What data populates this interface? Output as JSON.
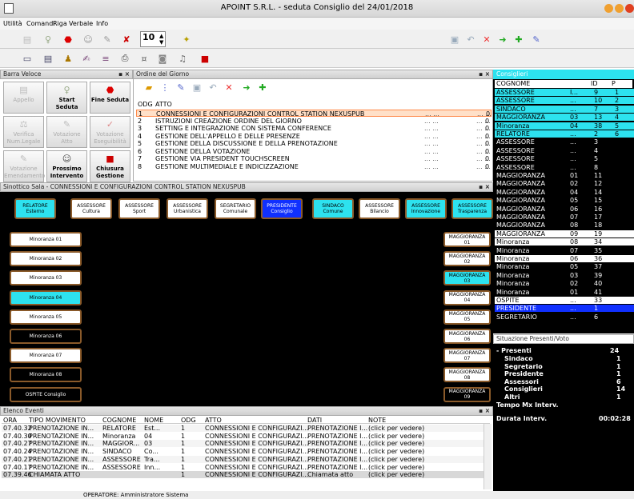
{
  "window": {
    "title": "APOINT S.R.L. - seduta  Consiglio  del  24/01/2018"
  },
  "menu": [
    "Utilità",
    "Comandi",
    "Riga",
    "Verbale",
    "Info"
  ],
  "toolbar1": {
    "zoom_value": "10"
  },
  "quick": {
    "title": "Barra Veloce",
    "buttons": [
      {
        "label": "Appello",
        "icon": "document-icon",
        "enabled": false
      },
      {
        "label": "Start Seduta",
        "icon": "bell-icon",
        "enabled": true
      },
      {
        "label": "Fine Seduta",
        "icon": "stop-icon",
        "enabled": true
      },
      {
        "label": "Verifica Num.Legale",
        "icon": "gavel-icon",
        "enabled": false
      },
      {
        "label": "Votazione Atto",
        "icon": "vote-icon",
        "enabled": false
      },
      {
        "label": "Votazione Eseguibilità",
        "icon": "check-icon",
        "enabled": false
      },
      {
        "label": "Votazione Emendamento",
        "icon": "vote-icon",
        "enabled": false
      },
      {
        "label": "Prossimo Intervento",
        "icon": "speech-icon",
        "enabled": true
      },
      {
        "label": "Chiusura Gestione",
        "icon": "stop-square-icon",
        "enabled": true
      }
    ]
  },
  "odg": {
    "title": "Ordine del Giorno",
    "col_odg": "ODG",
    "col_atto": "ATTO",
    "rows": [
      {
        "n": "1",
        "atto": "CONNESSIONI E CONFIGURAZIONI CONTROL STATION NEXUSPUB",
        "v": "0"
      },
      {
        "n": "2",
        "atto": "ISTRUZIONI CREAZIONE ORDINE DEL GIORNO",
        "v": "0"
      },
      {
        "n": "3",
        "atto": "SETTING E INTEGRAZIONE CON SISTEMA CONFERENCE",
        "v": "0"
      },
      {
        "n": "4",
        "atto": "GESTIONE DELL'APPELLO E DELLE PRESENZE",
        "v": "0"
      },
      {
        "n": "5",
        "atto": "GESTIONE DELLA DISCUSSIONE E DELLA PRENOTAZIONE",
        "v": "0"
      },
      {
        "n": "6",
        "atto": "GESTIONE DELLA VOTAZIONE",
        "v": "0"
      },
      {
        "n": "7",
        "atto": "GESTIONE VIA PRESIDENT TOUCHSCREEN",
        "v": "0"
      },
      {
        "n": "8",
        "atto": "GESTIONE MULTIMEDIALE E INDICIZZAZIONE",
        "v": "0"
      }
    ],
    "dots": "... ..."
  },
  "consiglieri": {
    "title": "Consiglieri",
    "col_cognome": "COGNOME",
    "col_id": "ID",
    "col_p": "P",
    "rows": [
      {
        "c": "ASSESSORE",
        "n": "I...",
        "id": "9",
        "p": "1",
        "bg": "#2de2ef",
        "fg": "#000"
      },
      {
        "c": "ASSESSORE",
        "n": "...",
        "id": "10",
        "p": "2",
        "bg": "#2de2ef",
        "fg": "#000"
      },
      {
        "c": "SINDACO",
        "n": "...",
        "id": "7",
        "p": "3",
        "bg": "#2de2ef",
        "fg": "#000"
      },
      {
        "c": "MAGGIORANZA",
        "n": "03",
        "id": "13",
        "p": "4",
        "bg": "#2de2ef",
        "fg": "#000"
      },
      {
        "c": "Minoranza",
        "n": "04",
        "id": "38",
        "p": "5",
        "bg": "#2de2ef",
        "fg": "#000"
      },
      {
        "c": "RELATORE",
        "n": "...",
        "id": "2",
        "p": "6",
        "bg": "#2de2ef",
        "fg": "#000"
      },
      {
        "c": "ASSESSORE",
        "n": "...",
        "id": "3",
        "p": "",
        "bg": "#000",
        "fg": "#fff"
      },
      {
        "c": "ASSESSORE",
        "n": "...",
        "id": "4",
        "p": "",
        "bg": "#000",
        "fg": "#fff"
      },
      {
        "c": "ASSESSORE",
        "n": "...",
        "id": "5",
        "p": "",
        "bg": "#000",
        "fg": "#fff"
      },
      {
        "c": "ASSESSORE",
        "n": "...",
        "id": "8",
        "p": "",
        "bg": "#000",
        "fg": "#fff"
      },
      {
        "c": "MAGGIORANZA",
        "n": "01",
        "id": "11",
        "p": "",
        "bg": "#000",
        "fg": "#fff"
      },
      {
        "c": "MAGGIORANZA",
        "n": "02",
        "id": "12",
        "p": "",
        "bg": "#000",
        "fg": "#fff"
      },
      {
        "c": "MAGGIORANZA",
        "n": "04",
        "id": "14",
        "p": "",
        "bg": "#000",
        "fg": "#fff"
      },
      {
        "c": "MAGGIORANZA",
        "n": "05",
        "id": "15",
        "p": "",
        "bg": "#000",
        "fg": "#fff"
      },
      {
        "c": "MAGGIORANZA",
        "n": "06",
        "id": "16",
        "p": "",
        "bg": "#000",
        "fg": "#fff"
      },
      {
        "c": "MAGGIORANZA",
        "n": "07",
        "id": "17",
        "p": "",
        "bg": "#000",
        "fg": "#fff"
      },
      {
        "c": "MAGGIORANZA",
        "n": "08",
        "id": "18",
        "p": "",
        "bg": "#000",
        "fg": "#fff"
      },
      {
        "c": "MAGGIORANZA",
        "n": "09",
        "id": "19",
        "p": "",
        "bg": "#fff",
        "fg": "#000"
      },
      {
        "c": "Minoranza",
        "n": "08",
        "id": "34",
        "p": "",
        "bg": "#fff",
        "fg": "#000"
      },
      {
        "c": "Minoranza",
        "n": "07",
        "id": "35",
        "p": "",
        "bg": "#000",
        "fg": "#fff"
      },
      {
        "c": "Minoranza",
        "n": "06",
        "id": "36",
        "p": "",
        "bg": "#fff",
        "fg": "#000"
      },
      {
        "c": "Minoranza",
        "n": "05",
        "id": "37",
        "p": "",
        "bg": "#000",
        "fg": "#fff"
      },
      {
        "c": "Minoranza",
        "n": "03",
        "id": "39",
        "p": "",
        "bg": "#000",
        "fg": "#fff"
      },
      {
        "c": "Minoranza",
        "n": "02",
        "id": "40",
        "p": "",
        "bg": "#000",
        "fg": "#fff"
      },
      {
        "c": "Minoranza",
        "n": "01",
        "id": "41",
        "p": "",
        "bg": "#000",
        "fg": "#fff"
      },
      {
        "c": "OSPITE",
        "n": "...",
        "id": "33",
        "p": "",
        "bg": "#fff",
        "fg": "#000"
      },
      {
        "c": "PRESIDENTE",
        "n": "...",
        "id": "1",
        "p": "",
        "bg": "#1030ff",
        "fg": "#fff"
      },
      {
        "c": "SEGRETARIO",
        "n": "...",
        "id": "6",
        "p": "",
        "bg": "#000",
        "fg": "#fff"
      }
    ]
  },
  "situazione": {
    "title": "Situazione Presenti/Voto",
    "presenti_label": "- Presenti",
    "presenti_value": "24",
    "items": [
      {
        "label": "Sindaco",
        "value": "1"
      },
      {
        "label": "Segretario",
        "value": "1"
      },
      {
        "label": "Presidente",
        "value": "1"
      },
      {
        "label": "Assessori",
        "value": "6"
      },
      {
        "label": "Consiglieri",
        "value": "14"
      },
      {
        "label": "Altri",
        "value": "1"
      }
    ],
    "tempo_label": "Tempo Mx Interv.",
    "durata_label": "Durata Interv.",
    "durata_value": "00:02:28"
  },
  "sinottico": {
    "title": "Sinottico Sala - CONNESSIONI E CONFIGURAZIONI CONTROL STATION NEXUSPUB",
    "top": [
      {
        "a": "RELATORE",
        "b": "Esterno",
        "style": "cyan"
      },
      {
        "a": "ASSESSORE",
        "b": "Cultura",
        "style": "white"
      },
      {
        "a": "ASSESSORE",
        "b": "Sport",
        "style": "white"
      },
      {
        "a": "ASSESSORE",
        "b": "Urbanistica",
        "style": "white"
      },
      {
        "a": "SEGRETARIO",
        "b": "Comunale",
        "style": "white"
      },
      {
        "a": "PRESIDENTE",
        "b": "Consiglio",
        "style": "blue"
      },
      {
        "a": "SINDACO Comune",
        "b": "",
        "style": "cyan"
      },
      {
        "a": "ASSESSORE",
        "b": "Bilancio",
        "style": "white"
      },
      {
        "a": "ASSESSORE",
        "b": "Innovazione",
        "style": "cyan"
      },
      {
        "a": "ASSESSORE",
        "b": "Trasparenza",
        "style": "cyan"
      }
    ],
    "left": [
      {
        "a": "Minoranza 01",
        "style": "white"
      },
      {
        "a": "Minoranza 02",
        "style": "white"
      },
      {
        "a": "Minoranza 03",
        "style": "white"
      },
      {
        "a": "Minoranza 04",
        "style": "cyan"
      },
      {
        "a": "Minoranza 05",
        "style": "white"
      },
      {
        "a": "Minoranza 06",
        "style": "blk"
      },
      {
        "a": "Minoranza 07",
        "style": "white"
      },
      {
        "a": "Minoranza 08",
        "style": "blk"
      },
      {
        "a": "OSPITE Consiglio",
        "style": "blk"
      }
    ],
    "right": [
      {
        "a": "MAGGIORANZA 01",
        "style": "white"
      },
      {
        "a": "MAGGIORANZA 02",
        "style": "white"
      },
      {
        "a": "MAGGIORANZA 03",
        "style": "cyan"
      },
      {
        "a": "MAGGIORANZA 04",
        "style": "white"
      },
      {
        "a": "MAGGIORANZA 05",
        "style": "white"
      },
      {
        "a": "MAGGIORANZA 06",
        "style": "white"
      },
      {
        "a": "MAGGIORANZA 07",
        "style": "white"
      },
      {
        "a": "MAGGIORANZA 08",
        "style": "white"
      },
      {
        "a": "MAGGIORANZA 09",
        "style": "blk"
      }
    ]
  },
  "eventi": {
    "title": "Elenco Eventi",
    "headers": [
      "ORA",
      "TIPO MOVIMENTO",
      "COGNOME",
      "NOME",
      "ODG",
      "ATTO",
      "DATI",
      "NOTE"
    ],
    "rows": [
      [
        "07.40.32",
        "PRENOTAZIONE IN...",
        "RELATORE",
        "Est...",
        "1",
        "CONNESSIONI E CONFIGURAZI...",
        "PRENOTAZIONE I...",
        "(click per vedere)"
      ],
      [
        "07.40.30",
        "PRENOTAZIONE IN...",
        "Minoranza",
        "04",
        "1",
        "CONNESSIONI E CONFIGURAZI...",
        "PRENOTAZIONE I...",
        "(click per vedere)"
      ],
      [
        "07.40.27",
        "PRENOTAZIONE IN...",
        "MAGGIOR...",
        "03",
        "1",
        "CONNESSIONI E CONFIGURAZI...",
        "PRENOTAZIONE I...",
        "(click per vedere)"
      ],
      [
        "07.40.24",
        "PRENOTAZIONE IN...",
        "SINDACO",
        "Co...",
        "1",
        "CONNESSIONI E CONFIGURAZI...",
        "PRENOTAZIONE I...",
        "(click per vedere)"
      ],
      [
        "07.40.21",
        "PRENOTAZIONE IN...",
        "ASSESSORE",
        "Tra...",
        "1",
        "CONNESSIONI E CONFIGURAZI...",
        "PRENOTAZIONE I...",
        "(click per vedere)"
      ],
      [
        "07.40.17",
        "PRENOTAZIONE IN...",
        "ASSESSORE",
        "Inn...",
        "1",
        "CONNESSIONI E CONFIGURAZI...",
        "PRENOTAZIONE I...",
        "(click per vedere)"
      ],
      [
        "07.39.46",
        "CHIAMATA ATTO",
        "",
        "",
        "1",
        "CONNESSIONI E CONFIGURAZI...",
        "Chiamata atto",
        "(click per vedere)"
      ]
    ]
  },
  "status": {
    "operator": "OPERATORE: Amministratore Sistema"
  }
}
